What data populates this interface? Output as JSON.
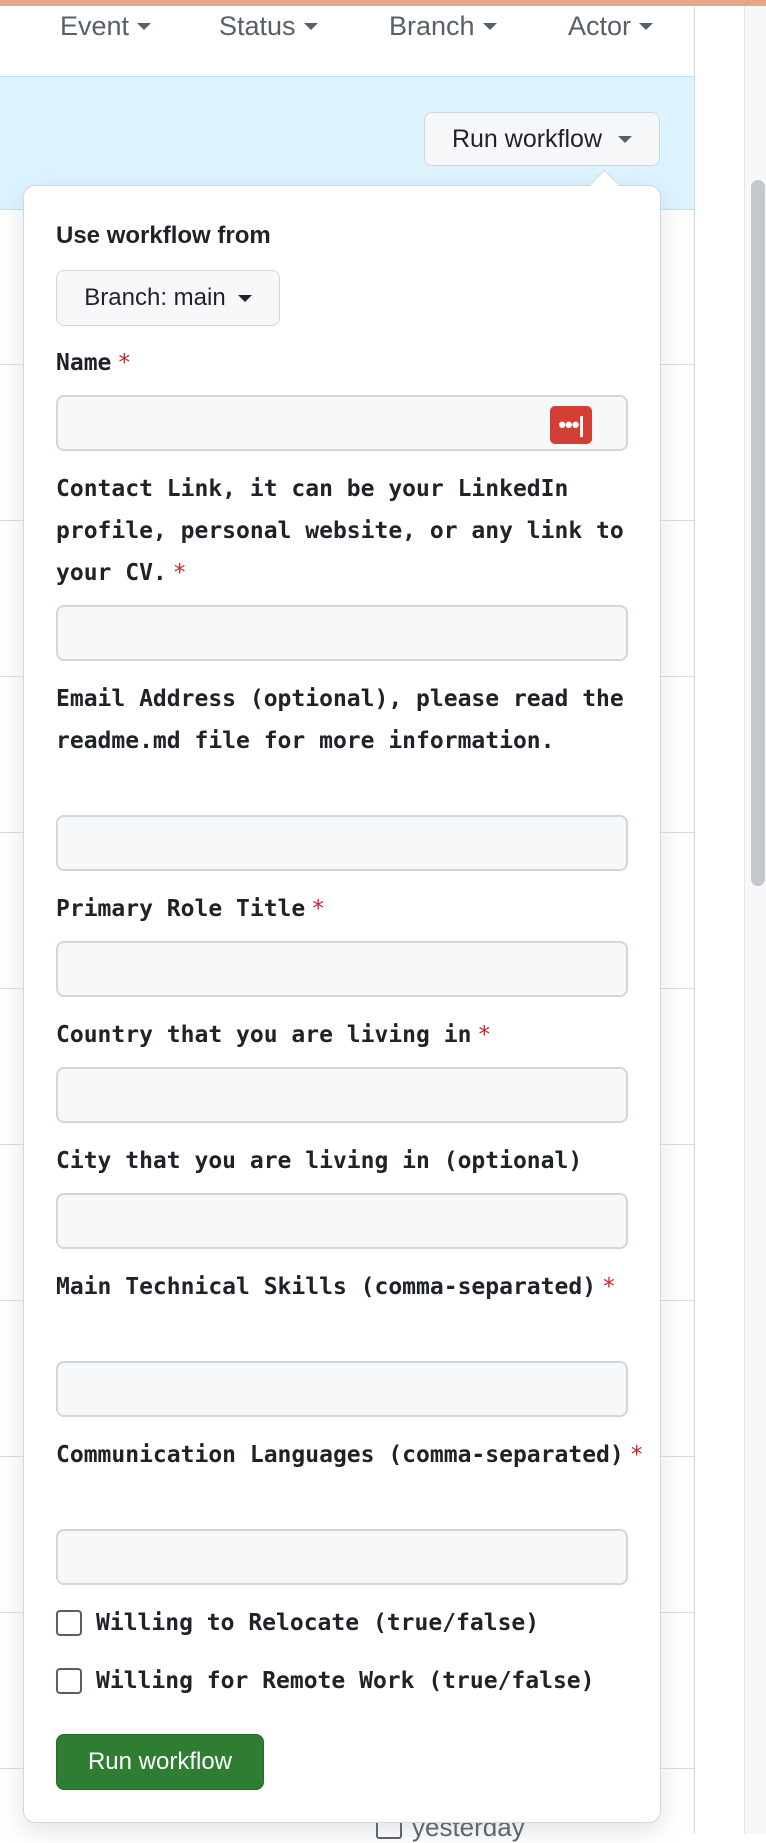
{
  "filters": [
    {
      "label": "Event"
    },
    {
      "label": "Status"
    },
    {
      "label": "Branch"
    },
    {
      "label": "Actor"
    }
  ],
  "run_workflow_top": "Run workflow",
  "popover": {
    "use_workflow_from": "Use workflow from",
    "branch_selector": "Branch: main",
    "required_marker": "*",
    "fields": [
      {
        "label": "Name",
        "required": true
      },
      {
        "label": "Contact Link, it can be your LinkedIn profile, personal website, or any link to your CV.",
        "required": true
      },
      {
        "label": "Email Address (optional), please read the readme.md file for more information.",
        "required": false
      },
      {
        "label": "Primary Role Title",
        "required": true
      },
      {
        "label": "Country that you are living in",
        "required": true
      },
      {
        "label": "City that you are living in (optional)",
        "required": false
      },
      {
        "label": "Main Technical Skills (comma-separated)",
        "required": true
      },
      {
        "label": "Communication Languages (comma-separated)",
        "required": true
      }
    ],
    "checkboxes": [
      {
        "label": "Willing to Relocate (true/false)",
        "checked": false
      },
      {
        "label": "Willing for Remote Work (true/false)",
        "checked": false
      }
    ],
    "submit": "Run workflow"
  },
  "background": {
    "timestamp": "yesterday"
  },
  "colors": {
    "banner": "#ddf4ff",
    "primary_button": "#2e7d32",
    "required": "#cf222e",
    "password_manager": "#d33f33"
  },
  "icons": [
    "caret-down-icon",
    "password-manager-icon",
    "calendar-icon"
  ]
}
